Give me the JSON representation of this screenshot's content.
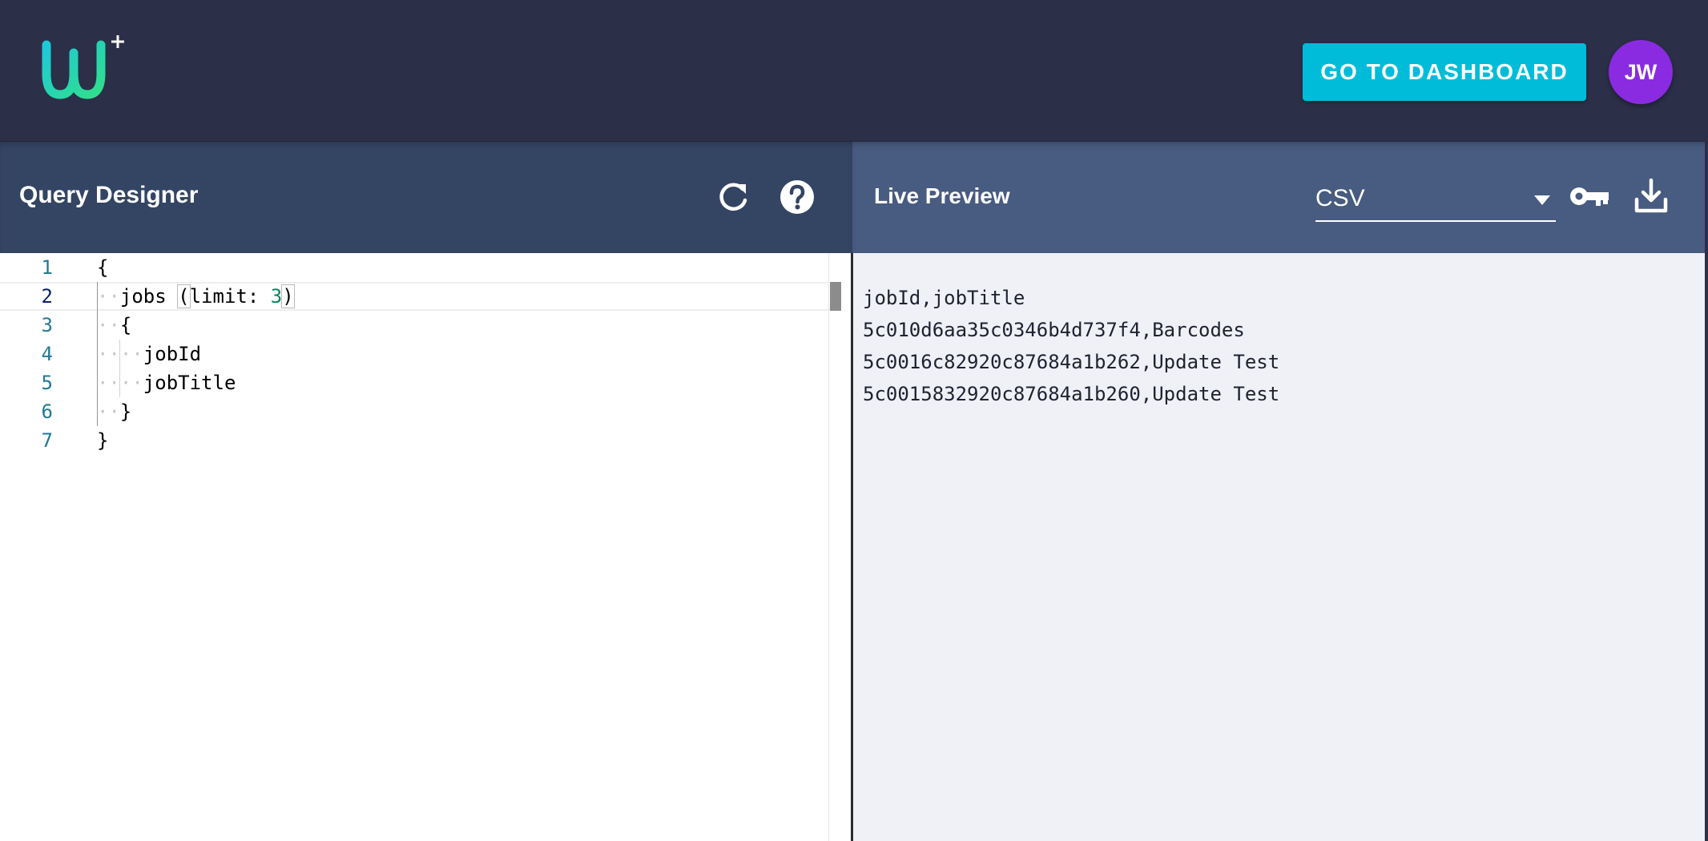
{
  "app": {
    "logo_name": "w-plus-logo",
    "dashboard_button": "GO TO DASHBOARD",
    "avatar_initials": "JW"
  },
  "query_designer": {
    "title": "Query Designer",
    "icons": [
      "refresh-icon",
      "help-icon"
    ],
    "lines": [
      {
        "number": "1",
        "text": "{"
      },
      {
        "number": "2",
        "text": "jobs (limit: 3)"
      },
      {
        "number": "3",
        "text": "{"
      },
      {
        "number": "4",
        "text": "jobId"
      },
      {
        "number": "5",
        "text": "jobTitle"
      },
      {
        "number": "6",
        "text": "}"
      },
      {
        "number": "7",
        "text": "}"
      }
    ],
    "active_line": "2"
  },
  "live_preview": {
    "title": "Live Preview",
    "format": "CSV",
    "icons": [
      "key-icon",
      "download-icon"
    ],
    "output_lines": [
      "jobId,jobTitle",
      "5c010d6aa35c0346b4d737f4,Barcodes",
      "5c0016c82920c87684a1b262,Update Test",
      "5c0015832920c87684a1b260,Update Test"
    ]
  },
  "colors": {
    "appbar": "#2b2f48",
    "left_header": "#344563",
    "right_header": "#485b80",
    "accent_button": "#00bcd9",
    "avatar": "#8a2be2",
    "preview_bg": "#f0f1f7"
  }
}
